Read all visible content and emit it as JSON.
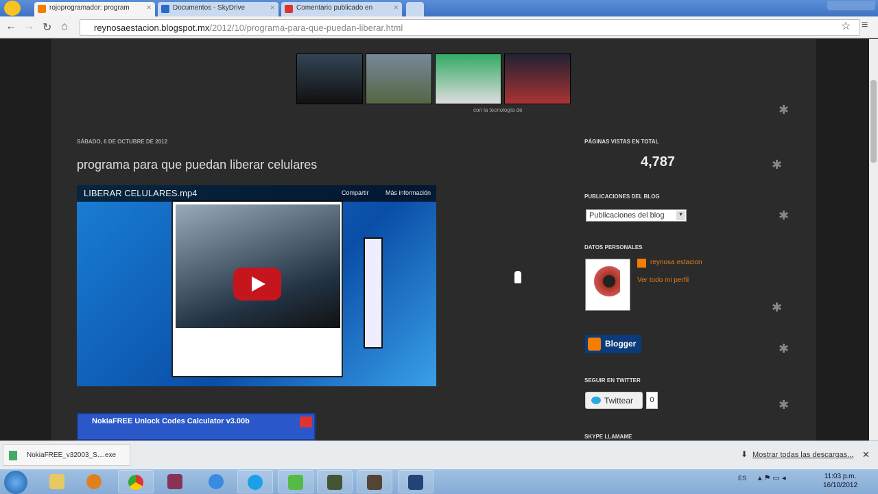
{
  "browser": {
    "tabs": [
      {
        "label": "rojoprogramador: program",
        "color": "#f57d00",
        "active": true
      },
      {
        "label": "Documentos - SkyDrive",
        "color": "#2a6ac8",
        "active": false
      },
      {
        "label": "Comentario publicado en",
        "color": "#d33",
        "active": false
      }
    ],
    "url_host": "reynosaestacion.blogspot.mx",
    "url_path": "/2012/10/programa-para-que-puedan-liberar.html"
  },
  "page": {
    "powered_by": "con la tecnología de",
    "post_date": "SÁBADO, 6 DE OCTUBRE DE 2012",
    "post_title": "programa para que puedan liberar celulares",
    "video": {
      "title": "LIBERAR CELULARES.mp4",
      "share": "Compartir",
      "more_info": "Más información"
    },
    "window2_title": "NokiaFREE Unlock Codes Calculator v3.00b"
  },
  "sidebar": {
    "pageviews_title": "PÁGINAS VISTAS EN TOTAL",
    "pageviews": "4,787",
    "archive_title": "PUBLICACIONES DEL BLOG",
    "archive_select": "Publicaciones del blog",
    "profile_title": "DATOS PERSONALES",
    "profile_name": "reynosa estacion",
    "profile_link": "Ver todo mi perfil",
    "blogger_label": "Blogger",
    "twitter_title": "SEGUIR EN TWITTER",
    "tweet_label": "Twittear",
    "tweet_count": "0",
    "skype_title": "SKYPE LLAMAME"
  },
  "downloads": {
    "file": "NokiaFREE_v32003_S....exe",
    "show_all": "Mostrar todas las descargas..."
  },
  "taskbar": {
    "lang": "ES",
    "time": "11:03 p.m.",
    "date": "16/10/2012"
  }
}
